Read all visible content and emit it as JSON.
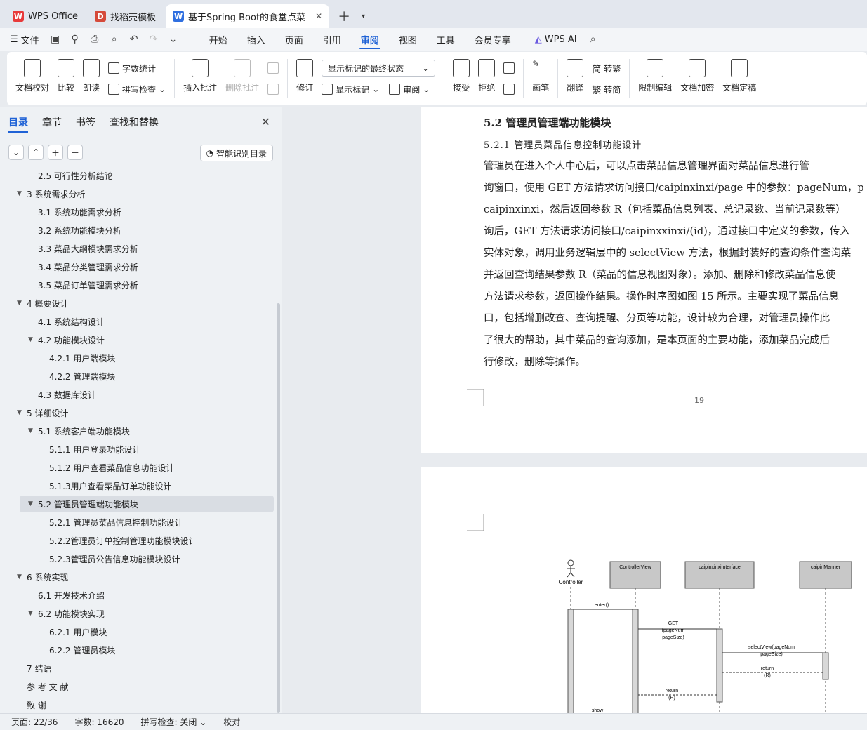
{
  "tabs": [
    {
      "label": "WPS Office",
      "icon": "wps-logo-icon"
    },
    {
      "label": "找稻壳模板",
      "icon": "docer-icon"
    },
    {
      "label": "基于Spring Boot的食堂点菜",
      "icon": "word-doc-icon"
    }
  ],
  "menu": {
    "file": "文件",
    "tabs": [
      "开始",
      "插入",
      "页面",
      "引用",
      "审阅",
      "视图",
      "工具",
      "会员专享"
    ],
    "active_tab": "审阅",
    "wps_ai": "WPS AI"
  },
  "ribbon": {
    "doc_check": "文档校对",
    "compare": "比较",
    "read_aloud": "朗读",
    "word_count": "字数统计",
    "spell_check": "拼写检查",
    "insert_comment": "插入批注",
    "delete_comment": "删除批注",
    "track_changes": "修订",
    "markup_state": "显示标记的最终状态",
    "show_markup": "显示标记",
    "review": "审阅",
    "accept": "接受",
    "reject": "拒绝",
    "pen": "画笔",
    "translate": "翻译",
    "to_traditional": "转繁",
    "to_simplified": "转简",
    "restrict_edit": "限制编辑",
    "encrypt": "文档加密",
    "finalize": "文档定稿"
  },
  "nav": {
    "tabs": [
      "目录",
      "章节",
      "书签",
      "查找和替换"
    ],
    "active": "目录",
    "smart_btn": "智能识别目录",
    "items": [
      {
        "text": "2.5 可行性分析结论",
        "level": 2,
        "toggle": ""
      },
      {
        "text": "3  系统需求分析",
        "level": 1,
        "toggle": "▼"
      },
      {
        "text": "3.1  系统功能需求分析",
        "level": 2,
        "toggle": ""
      },
      {
        "text": "3.2  系统功能模块分析",
        "level": 2,
        "toggle": ""
      },
      {
        "text": "3.3  菜品大纲模块需求分析",
        "level": 2,
        "toggle": ""
      },
      {
        "text": "3.4  菜品分类管理需求分析",
        "level": 2,
        "toggle": ""
      },
      {
        "text": "3.5  菜品订单管理需求分析",
        "level": 2,
        "toggle": ""
      },
      {
        "text": "4  概要设计",
        "level": 1,
        "toggle": "▼"
      },
      {
        "text": "4.1  系统结构设计",
        "level": 2,
        "toggle": ""
      },
      {
        "text": "4.2  功能模块设计",
        "level": 2,
        "toggle": "▼"
      },
      {
        "text": "4.2.1  用户端模块",
        "level": 3,
        "toggle": ""
      },
      {
        "text": "4.2.2  管理端模块",
        "level": 3,
        "toggle": ""
      },
      {
        "text": "4.3  数据库设计",
        "level": 2,
        "toggle": ""
      },
      {
        "text": "5  详细设计",
        "level": 1,
        "toggle": "▼"
      },
      {
        "text": "5.1  系统客户端功能模块",
        "level": 2,
        "toggle": "▼"
      },
      {
        "text": "5.1.1  用户登录功能设计",
        "level": 3,
        "toggle": ""
      },
      {
        "text": "5.1.2  用户查看菜品信息功能设计",
        "level": 3,
        "toggle": ""
      },
      {
        "text": "5.1.3用户查看菜品订单功能设计",
        "level": 3,
        "toggle": ""
      },
      {
        "text": "5.2  管理员管理端功能模块",
        "level": 2,
        "toggle": "▼"
      },
      {
        "text": "5.2.1  管理员菜品信息控制功能设计",
        "level": 3,
        "toggle": ""
      },
      {
        "text": "5.2.2管理员订单控制管理功能模块设计",
        "level": 3,
        "toggle": ""
      },
      {
        "text": "5.2.3管理员公告信息功能模块设计",
        "level": 3,
        "toggle": ""
      },
      {
        "text": "6  系统实现",
        "level": 1,
        "toggle": "▼"
      },
      {
        "text": "6.1  开发技术介绍",
        "level": 2,
        "toggle": ""
      },
      {
        "text": "6.2  功能模块实现",
        "level": 2,
        "toggle": "▼"
      },
      {
        "text": "6.2.1  用户模块",
        "level": 3,
        "toggle": ""
      },
      {
        "text": "6.2.2  管理员模块",
        "level": 3,
        "toggle": ""
      },
      {
        "text": "7  结语",
        "level": 1,
        "toggle": ""
      },
      {
        "text": "参   考   文   献",
        "level": 1,
        "toggle": ""
      },
      {
        "text": "致        谢",
        "level": 1,
        "toggle": ""
      }
    ],
    "selected_index": 18
  },
  "doc": {
    "heading2": "5.2  管理员管理端功能模块",
    "heading3": "5.2.1  管理员菜品信息控制功能设计",
    "lines": [
      "    管理员在进入个人中心后，可以点击菜品信息管理界面对菜品信息进行管",
      "询窗口，使用 GET 方法请求访问接口/caipinxinxi/page 中的参数：pageNum，p",
      "caipinxinxi，然后返回参数 R（包括菜品信息列表、总记录数、当前记录数等）",
      "询后，GET 方法请求访问接口/caipinxxinxi/(id)，通过接口中定义的参数，传入",
      "实体对象，调用业务逻辑层中的 selectView 方法，根据封装好的查询条件查询菜",
      "并返回查询结果参数 R（菜品的信息视图对象）。添加、删除和修改菜品信息使",
      "方法请求参数，返回操作结果。操作时序图如图 15 所示。主要实现了菜品信息",
      "口，包括增删改查、查询提醒、分页等功能，设计较为合理，对管理员操作此",
      "了很大的帮助，其中菜品的查询添加，是本页面的主要功能，添加菜品完成后",
      "行修改，删除等操作。"
    ],
    "page_number": "19"
  },
  "seq_diagram": {
    "actor": "Controller",
    "lifelines": [
      "ControllerView",
      "caipinxinxiInterface",
      "caipinManner"
    ],
    "messages": [
      "enter()",
      "GET",
      "(pageNum",
      "pageSize)",
      "selectView(pageNum",
      "pageSize)",
      "return",
      "(R)",
      "return",
      "(R)",
      "show"
    ]
  },
  "status": {
    "page": "页面: 22/36",
    "words": "字数: 16620",
    "spell": "拼写检查: 关闭",
    "proof": "校对"
  }
}
